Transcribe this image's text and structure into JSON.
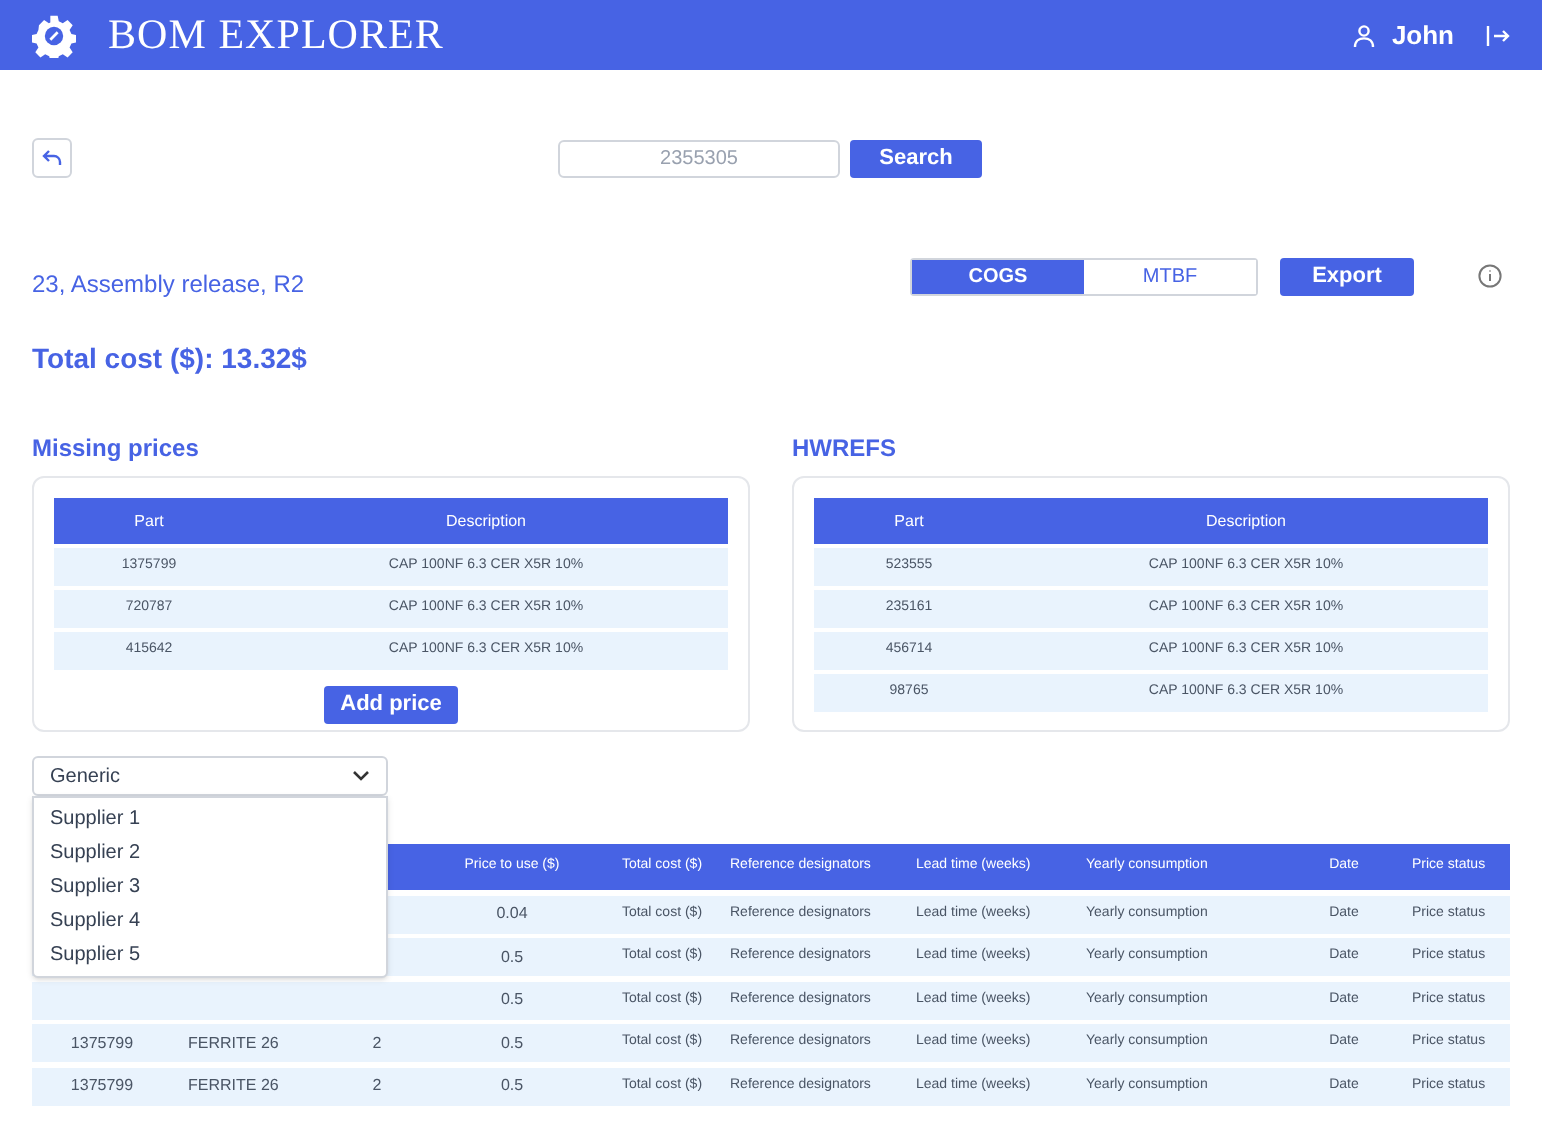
{
  "app": {
    "title": "BOM EXPLORER",
    "user": "John"
  },
  "search": {
    "value": "2355305",
    "button": "Search"
  },
  "assembly": {
    "subtitle": "23, Assembly release, R2",
    "total_cost": "Total cost ($): 13.32$"
  },
  "view_tabs": [
    {
      "label": "COGS",
      "selected": true
    },
    {
      "label": "MTBF",
      "selected": false
    }
  ],
  "export_button": "Export",
  "missing_prices": {
    "title": "Missing prices",
    "columns": [
      "Part",
      "Description"
    ],
    "rows": [
      [
        "1375799",
        "CAP 100NF 6.3 CER X5R 10%"
      ],
      [
        "720787",
        "CAP 100NF 6.3 CER X5R 10%"
      ],
      [
        "415642",
        "CAP 100NF 6.3 CER X5R 10%"
      ]
    ],
    "button": "Add price"
  },
  "hwrefs": {
    "title": "HWREFS",
    "columns": [
      "Part",
      "Description"
    ],
    "rows": [
      [
        "523555",
        "CAP 100NF 6.3 CER X5R 10%"
      ],
      [
        "235161",
        "CAP 100NF 6.3 CER X5R 10%"
      ],
      [
        "456714",
        "CAP 100NF 6.3 CER X5R 10%"
      ],
      [
        "98765",
        "CAP 100NF 6.3 CER X5R 10%"
      ]
    ]
  },
  "supplier_dropdown": {
    "value": "Generic",
    "expanded": true,
    "options": [
      "Supplier 1",
      "Supplier 2",
      "Supplier 3",
      "Supplier 4",
      "Supplier 5"
    ]
  },
  "bom_table": {
    "columns": [
      "Price to use ($)",
      "Total cost ($)",
      "Reference designators",
      "Lead time (weeks)",
      "Yearly consumption",
      "Date",
      "Price status"
    ],
    "rows": [
      {
        "cells": [
          "0.04",
          "Total cost ($)",
          "Reference designators",
          "Lead time (weeks)",
          "Yearly consumption",
          "Date",
          "Price status"
        ]
      },
      {
        "cells": [
          "0.5",
          "Total cost ($)",
          "Reference designators",
          "Lead time (weeks)",
          "Yearly consumption",
          "Date",
          "Price status"
        ]
      },
      {
        "cells": [
          "0.5",
          "Total cost ($)",
          "Reference designators",
          "Lead time (weeks)",
          "Yearly consumption",
          "Date",
          "Price status"
        ]
      },
      {
        "cells": [
          "1375799",
          "FERRITE 26",
          "2",
          "0.5",
          "Total cost ($)",
          "Reference designators",
          "Lead time (weeks)",
          "Yearly consumption",
          "Date",
          "Price status"
        ]
      },
      {
        "cells": [
          "1375799",
          "FERRITE 26",
          "2",
          "0.5",
          "Total cost ($)",
          "Reference designators",
          "Lead time (weeks)",
          "Yearly consumption",
          "Date",
          "Price status"
        ]
      }
    ]
  }
}
